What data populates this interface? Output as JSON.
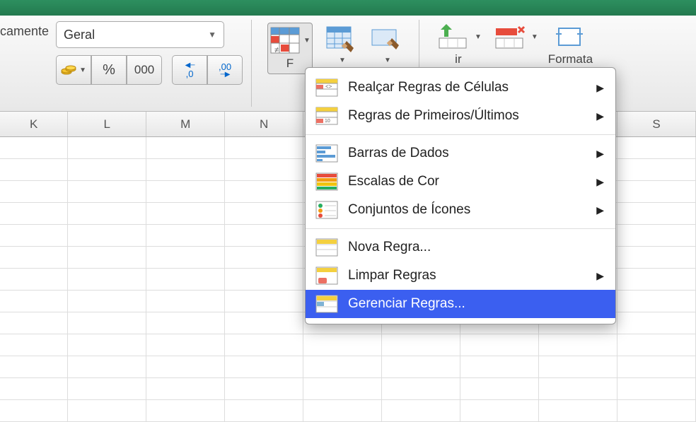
{
  "ribbon": {
    "left_label": "camente",
    "number_format": {
      "selected": "Geral",
      "percent": "%",
      "thousands": "000",
      "inc_dec": ",0",
      "dec_dec": ",00"
    },
    "cond_fmt_partial": "F",
    "insert_partial": "ir",
    "format_partial": "Formata"
  },
  "columns": [
    "K",
    "L",
    "M",
    "N",
    "",
    "",
    "",
    "S"
  ],
  "menu": {
    "items": [
      {
        "label": "Realçar Regras de Células",
        "submenu": true
      },
      {
        "label": "Regras de Primeiros/Últimos",
        "submenu": true
      }
    ],
    "items2": [
      {
        "label": "Barras de Dados",
        "submenu": true
      },
      {
        "label": "Escalas de Cor",
        "submenu": true
      },
      {
        "label": "Conjuntos de Ícones",
        "submenu": true
      }
    ],
    "items3": [
      {
        "label": "Nova Regra...",
        "submenu": false
      },
      {
        "label": "Limpar Regras",
        "submenu": true
      },
      {
        "label": "Gerenciar Regras...",
        "submenu": false,
        "highlight": true
      }
    ]
  }
}
